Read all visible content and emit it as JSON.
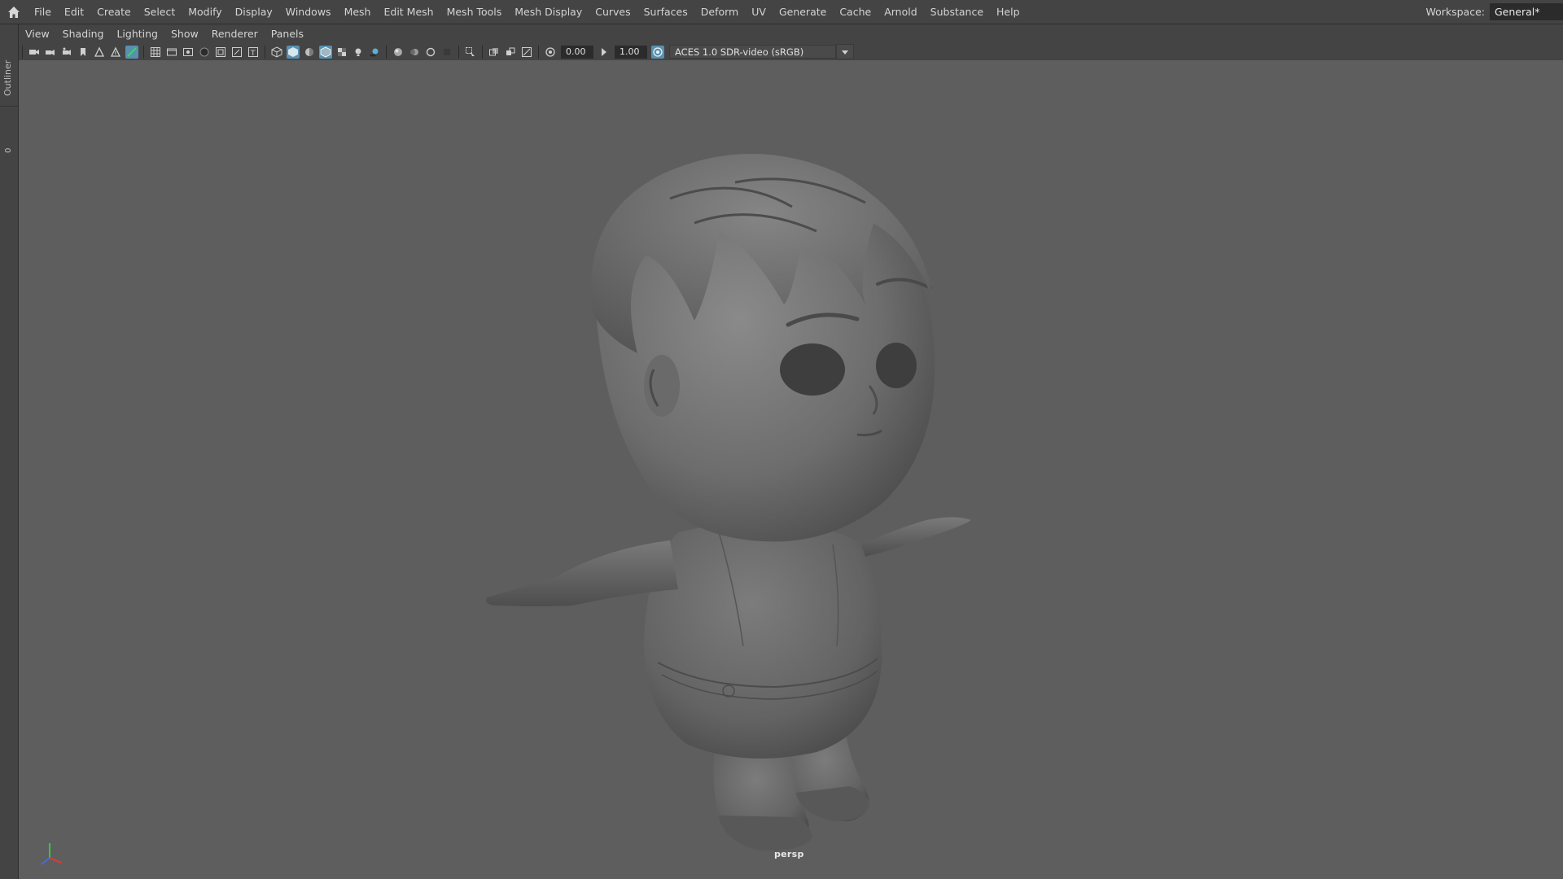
{
  "menubar": {
    "items": [
      "File",
      "Edit",
      "Create",
      "Select",
      "Modify",
      "Display",
      "Windows",
      "Mesh",
      "Edit Mesh",
      "Mesh Tools",
      "Mesh Display",
      "Curves",
      "Surfaces",
      "Deform",
      "UV",
      "Generate",
      "Cache",
      "Arnold",
      "Substance",
      "Help"
    ],
    "workspace_label": "Workspace:",
    "workspace_value": "General*"
  },
  "left_strip": {
    "outliner_label": "Outliner",
    "count": "0"
  },
  "panel_menu": {
    "items": [
      "View",
      "Shading",
      "Lighting",
      "Show",
      "Renderer",
      "Panels"
    ]
  },
  "toolbar": {
    "exposure": "0.00",
    "gamma": "1.00",
    "color_space": "ACES 1.0 SDR-video (sRGB)"
  },
  "viewport": {
    "camera_label": "persp",
    "background_color": "#5e5e5e"
  },
  "colors": {
    "accent": "#5a8fb0",
    "ui_bg": "#444444"
  }
}
